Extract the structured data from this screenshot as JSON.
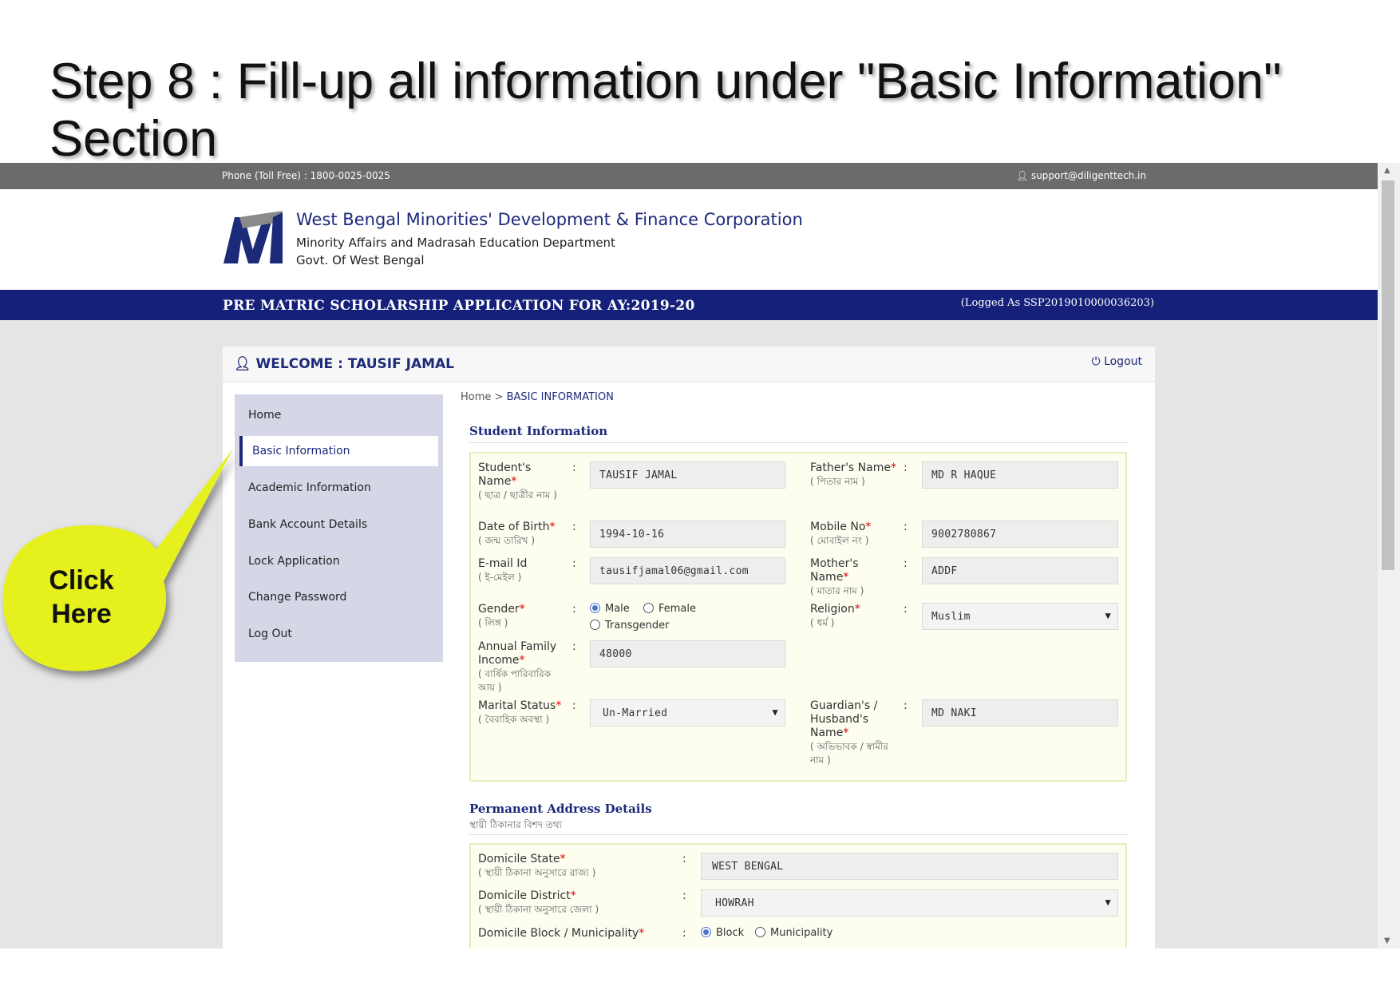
{
  "slide_title": "Step 8 : Fill-up all information under \"Basic Information\" Section",
  "callout": {
    "line1": "Click",
    "line2": "Here"
  },
  "topbar": {
    "phone": "Phone (Toll Free) : 1800-0025-0025",
    "email": "support@diligenttech.in"
  },
  "header": {
    "org": "West Bengal Minorities' Development & Finance Corporation",
    "dept": "Minority Affairs and Madrasah Education Department",
    "govt": "Govt. Of West Bengal"
  },
  "app_bar": {
    "title": "PRE MATRIC SCHOLARSHIP APPLICATION FOR AY:2019-20",
    "logged_as": "(Logged As SSP2019010000036203)"
  },
  "welcome": {
    "text": "WELCOME : TAUSIF JAMAL",
    "logout": "Logout"
  },
  "sidebar": {
    "items": [
      "Home",
      "Basic Information",
      "Academic Information",
      "Bank Account Details",
      "Lock Application",
      "Change Password",
      "Log Out"
    ],
    "active": "Basic Information"
  },
  "breadcrumb": {
    "home": "Home",
    "sep": ">",
    "current": "BASIC INFORMATION"
  },
  "student_section": {
    "title": "Student Information",
    "student_name": {
      "label": "Student's Name",
      "sub": "( ছাত্র / ছাত্রীর নাম )",
      "value": "TAUSIF JAMAL"
    },
    "father_name": {
      "label": "Father's Name",
      "sub": "( পিতার নাম )",
      "value": "MD R HAQUE"
    },
    "dob": {
      "label": "Date of Birth",
      "sub": "( জন্ম তারিখ )",
      "value": "1994-10-16"
    },
    "mobile": {
      "label": "Mobile No",
      "sub": "( মোবাইল নং )",
      "value": "9002780867"
    },
    "email": {
      "label": "E-mail Id",
      "sub": "( ই-মেইল )",
      "value": "tausifjamal06@gmail.com"
    },
    "mother_name": {
      "label": "Mother's Name",
      "sub": "( মাতার নাম )",
      "value": "ADDF"
    },
    "gender": {
      "label": "Gender",
      "sub": "( লিঙ্গ )",
      "options": [
        "Male",
        "Female",
        "Transgender"
      ],
      "selected": "Male"
    },
    "religion": {
      "label": "Religion",
      "sub": "( ধর্ম )",
      "value": "Muslim"
    },
    "income": {
      "label": "Annual Family Income",
      "sub": "( বার্ষিক পারিবারিক আয় )",
      "value": "48000"
    },
    "marital": {
      "label": "Marital Status",
      "sub": "( বৈবাহিক অবস্থা )",
      "value": "Un-Married"
    },
    "guardian": {
      "label": "Guardian's / Husband's Name",
      "sub": "( অভিভাবক / স্বামীর নাম )",
      "value": "MD NAKI"
    }
  },
  "address_section": {
    "title": "Permanent Address Details",
    "sub": "স্থায়ী ঠিকানার বিশদ তথ্য",
    "state": {
      "label": "Domicile State",
      "sub": "( স্থায়ী ঠিকানা অনুসারে রাজ্য )",
      "value": "WEST BENGAL"
    },
    "district": {
      "label": "Domicile District",
      "sub": "( স্থায়ী ঠিকানা অনুসারে জেলা )",
      "value": "HOWRAH"
    },
    "block": {
      "label": "Domicile Block / Municipality",
      "options": [
        "Block",
        "Municipality"
      ],
      "selected": "Block"
    }
  },
  "colors": {
    "brand_blue": "#14207a",
    "callout_yellow": "#e6f01e",
    "gray_bar": "#6b6b6b"
  }
}
